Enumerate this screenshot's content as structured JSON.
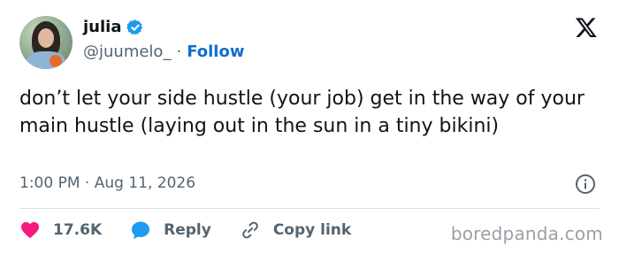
{
  "author": {
    "display_name": "julia",
    "handle": "@juumelo_",
    "separator": "·",
    "follow_label": "Follow"
  },
  "tweet": {
    "text": "don’t let your side hustle (your job) get in the way of your main hustle (laying out in the sun in a tiny bikini)",
    "timestamp": "1:00 PM · Aug 11, 2026"
  },
  "actions": {
    "like_count": "17.6K",
    "reply_label": "Reply",
    "copy_link_label": "Copy link"
  },
  "watermark": "boredpanda.com",
  "colors": {
    "verified": "#1d9bf0",
    "link": "#0f6fcf",
    "heart": "#f91880",
    "reply_bubble": "#1d9bf0",
    "muted_text": "#536471"
  },
  "icons": [
    "verified-badge-icon",
    "x-logo-icon",
    "info-icon",
    "heart-icon",
    "reply-bubble-icon",
    "link-icon"
  ]
}
